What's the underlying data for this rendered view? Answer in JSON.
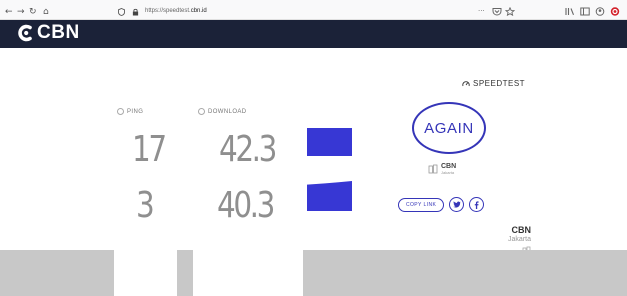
{
  "browser": {
    "url_prefix": "https://speedtest.",
    "url_host": "cbn.id",
    "page_actions": "···"
  },
  "header": {
    "logo_text": "CBN"
  },
  "speedtest": {
    "brand": "SPEEDTEST",
    "ping_label": "PING",
    "download_label": "DOWNLOAD",
    "ping_values": [
      "17",
      "3"
    ],
    "download_values": [
      "42.3",
      "40.3"
    ],
    "again_label": "AGAIN",
    "server_name": "CBN",
    "server_location": "Jakarta",
    "copy_link_label": "COPY LINK",
    "host_name": "CBN",
    "host_location": "Jakarta"
  },
  "colors": {
    "header_bg": "#1b2238",
    "accent": "#3535b8",
    "bar": "#3737d4",
    "number": "#8f8f8f"
  }
}
